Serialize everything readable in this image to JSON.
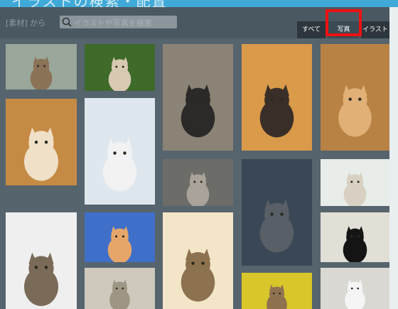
{
  "title": "イラストの検索・配置",
  "toolbar": {
    "breadcrumb": "[素材] から",
    "search_placeholder": "イラストや写真を検索",
    "filters": [
      {
        "label": "すべて",
        "active": false
      },
      {
        "label": "写真",
        "active": true
      },
      {
        "label": "イラスト",
        "active": false
      }
    ]
  },
  "colors": {
    "highlight": "#ee1111",
    "accent": "#3fa9d8"
  },
  "photos": [
    {
      "name": "two-tabby-cats",
      "bg": "#9aa79a",
      "cat": "#8b7358"
    },
    {
      "name": "siamese-cat-in-garden",
      "bg": "#3e6a2a",
      "cat": "#d8c9b3"
    },
    {
      "name": "cat-under-stairs",
      "bg": "#8b8376",
      "cat": "#2b2a28"
    },
    {
      "name": "fluffy-persian-cat",
      "bg": "#d99a4a",
      "cat": "#3a2f28"
    },
    {
      "name": "ginger-cat-walking",
      "bg": "#b88244",
      "cat": "#e1b076"
    },
    {
      "name": "orange-white-cat-sitting",
      "bg": "#c58b44",
      "cat": "#f0e0c8"
    },
    {
      "name": "cat-on-white-stairs",
      "bg": "#dfe7ee",
      "cat": "#f2f2f2"
    },
    {
      "name": "tabby-cat-face",
      "bg": "#6c6d68",
      "cat": "#a9a39a"
    },
    {
      "name": "cat-drinking-from-glass",
      "bg": "#3a4756",
      "cat": "#595f66"
    },
    {
      "name": "cat-under-bench",
      "bg": "#e8ede9",
      "cat": "#d8d0c2"
    },
    {
      "name": "tabby-white-door",
      "bg": "#efefef",
      "cat": "#7a6a58"
    },
    {
      "name": "cat-in-blue-window",
      "bg": "#3f6fc9",
      "cat": "#e6a66a"
    },
    {
      "name": "sunlit-tabby-portrait",
      "bg": "#f3e6c8",
      "cat": "#8d7250"
    },
    {
      "name": "black-cat-on-tiles",
      "bg": "#e2dfd6",
      "cat": "#141414"
    },
    {
      "name": "cat-on-steps",
      "bg": "#cfc9bd",
      "cat": "#9e9685"
    },
    {
      "name": "cat-yellow-background",
      "bg": "#d8c62a",
      "cat": "#8f7250"
    },
    {
      "name": "white-cat-corner",
      "bg": "#d9d8d2",
      "cat": "#f5f5f5"
    }
  ]
}
